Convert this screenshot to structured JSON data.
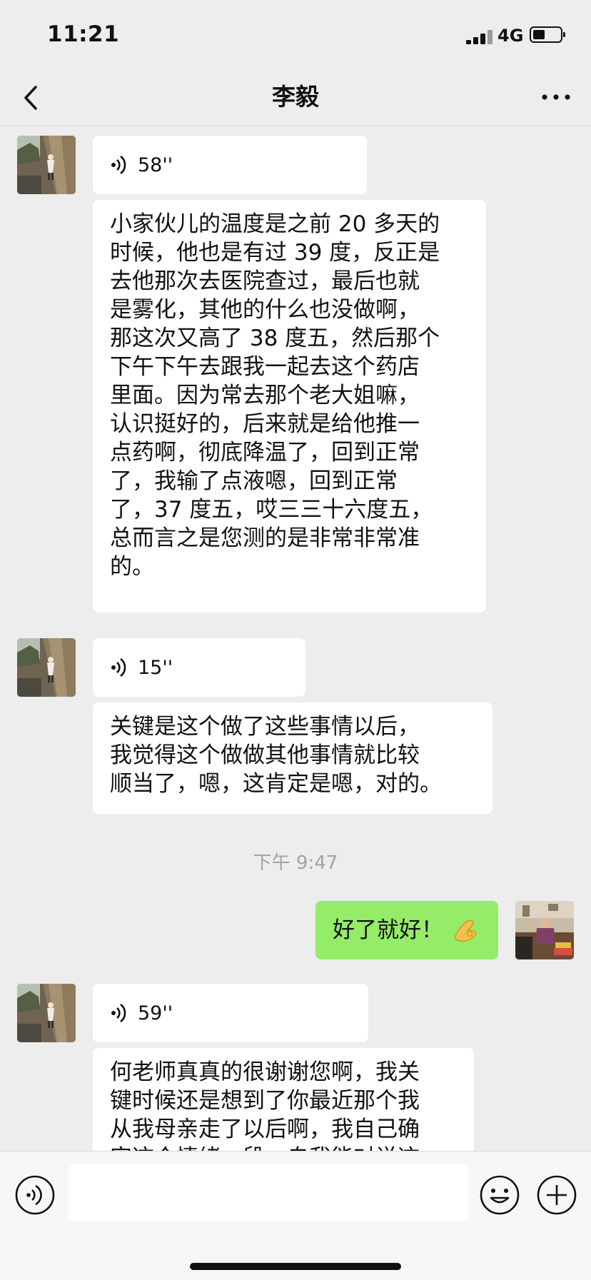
{
  "status_bar": {
    "time": "11:21",
    "network": "4G"
  },
  "nav": {
    "title": "李毅"
  },
  "messages": [
    {
      "sender": "contact",
      "type": "voice",
      "duration": "58''"
    },
    {
      "sender": "contact",
      "type": "text",
      "text": "小家伙儿的温度是之前 20 多天的\n时候，他也是有过 39 度，反正是\n去他那次去医院查过，最后也就\n是雾化，其他的什么也没做啊，\n那这次又高了 38 度五，然后那个\n下午下午去跟我一起去这个药店\n里面。因为常去那个老大姐嘛，\n认识挺好的，后来就是给他推一\n点药啊，彻底降温了，回到正常\n了，我输了点液嗯，回到正常\n了，37 度五，哎三三十六度五，\n总而言之是您测的是非常非常准\n的。"
    },
    {
      "sender": "contact",
      "type": "voice",
      "duration": "15''"
    },
    {
      "sender": "contact",
      "type": "text",
      "text": "关键是这个做了这些事情以后，\n我觉得这个做做其他事情就比较\n顺当了，嗯，这肯定是嗯，对的。"
    },
    {
      "sender": "self",
      "type": "text",
      "text": "好了就好！",
      "emoji": "ok-hand-icon"
    },
    {
      "sender": "contact",
      "type": "voice",
      "duration": "59''"
    },
    {
      "sender": "contact",
      "type": "text",
      "text": "何老师真真的很谢谢您啊，我关\n键时候还是想到了你最近那个我\n从我母亲走了以后啊，我自己确\n实这个情绪一段，自我能对说这"
    }
  ],
  "timestamp": "下午 9:47",
  "input_bar": {
    "placeholder": ""
  },
  "colors": {
    "background": "#ededed",
    "self_bubble": "#95ec69",
    "contact_bubble": "#ffffff"
  }
}
